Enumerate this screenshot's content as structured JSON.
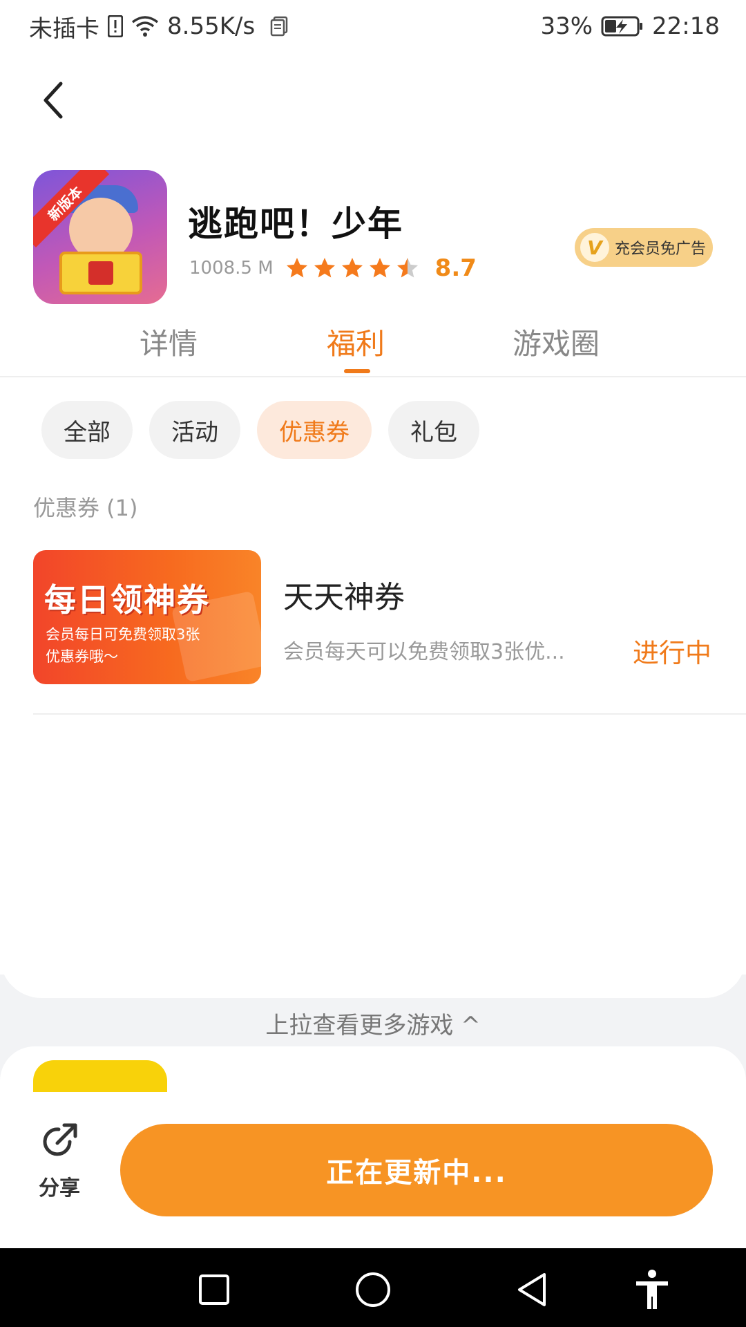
{
  "status_bar": {
    "carrier": "未插卡",
    "speed": "8.55K/s",
    "battery": "33%",
    "time": "22:18",
    "icons": [
      "sim-alert-icon",
      "wifi-icon",
      "document-icon",
      "battery-charging-icon"
    ]
  },
  "header": {
    "back_icon": "back-arrow-icon"
  },
  "app": {
    "title": "逃跑吧！少年",
    "size": "1008.5 M",
    "rating": "8.7",
    "rating_stars": 4.5,
    "icon_badge": "新版本",
    "vip_badge": {
      "icon": "V",
      "label": "充会员免广告"
    }
  },
  "tabs": [
    {
      "label": "详情",
      "active": false
    },
    {
      "label": "福利",
      "active": true
    },
    {
      "label": "游戏圈",
      "active": false
    }
  ],
  "filters": [
    {
      "label": "全部",
      "active": false
    },
    {
      "label": "活动",
      "active": false
    },
    {
      "label": "优惠券",
      "active": true
    },
    {
      "label": "礼包",
      "active": false
    }
  ],
  "section": {
    "label": "优惠券 (1)"
  },
  "coupon": {
    "banner_title": "每日领神券",
    "banner_subtitle": "会员每日可免费领取3张优惠券哦～",
    "name": "天天神券",
    "description": "会员每天可以免费领取3张优...",
    "status": "进行中"
  },
  "more": {
    "label": "上拉查看更多游戏 ^"
  },
  "actions": {
    "share_label": "分享",
    "update_label": "正在更新中..."
  },
  "colors": {
    "accent": "#f07a1a",
    "button": "#f79424",
    "vip_badge": "#f7d088"
  }
}
